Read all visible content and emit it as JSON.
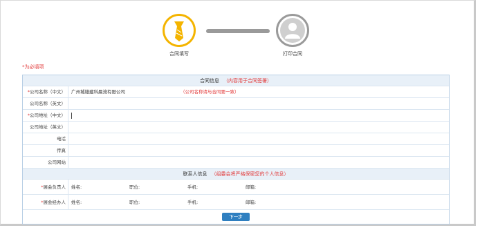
{
  "steps": [
    {
      "label": "合同填写",
      "state": "active",
      "icon": "tie-icon",
      "color": "#f4b400"
    },
    {
      "label": "打印合同",
      "state": "pending",
      "icon": "person-icon",
      "color": "#9a9a9a"
    }
  ],
  "required_note": "*为必填项",
  "contract_section": {
    "title": "合同信息",
    "hint": "（内容用于合同签署）"
  },
  "fields": [
    {
      "label": "公司名称（中文）",
      "required": true,
      "value": "广州城雄建科晨流有限公司",
      "hint": "（公司名称请与合同要一致）"
    },
    {
      "label": "公司名称（英文）",
      "required": false,
      "value": ""
    },
    {
      "label": "公司地址（中文）",
      "required": true,
      "value": ""
    },
    {
      "label": "公司地址（英文）",
      "required": false,
      "value": ""
    },
    {
      "label": "电话",
      "required": false,
      "value": ""
    },
    {
      "label": "传真",
      "required": false,
      "value": ""
    },
    {
      "label": "公司网站",
      "required": false,
      "value": ""
    }
  ],
  "contact_section": {
    "title": "联系人信息",
    "hint": "（组委会将严格保密您的个人信息）"
  },
  "contacts": [
    {
      "label": "展会负责人",
      "required": true,
      "name_label": "姓名:",
      "title_label": "职位:",
      "mobile_label": "手机:",
      "email_label": "邮箱:"
    },
    {
      "label": "展会经办人",
      "required": true,
      "name_label": "姓名:",
      "title_label": "职位:",
      "mobile_label": "手机:",
      "email_label": "邮箱:"
    }
  ],
  "next_button": "下一步",
  "colors": {
    "accent": "#2f7fc0",
    "required": "#e23b3b",
    "step_active": "#f4b400",
    "step_inactive": "#9a9a9a"
  }
}
